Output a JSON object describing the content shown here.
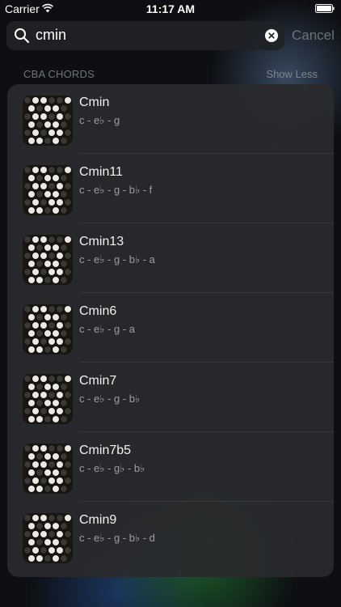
{
  "status_bar": {
    "carrier": "Carrier",
    "time": "11:17 AM"
  },
  "search": {
    "query": "cmin",
    "cancel_label": "Cancel"
  },
  "section": {
    "title": "CBA CHORDS",
    "toggle_label": "Show Less"
  },
  "results": [
    {
      "name": "Cmin",
      "notes": "c - e♭ - g"
    },
    {
      "name": "Cmin11",
      "notes": "c - e♭ - g - b♭ - f"
    },
    {
      "name": "Cmin13",
      "notes": "c - e♭ - g - b♭ - a"
    },
    {
      "name": "Cmin6",
      "notes": "c - e♭ - g - a"
    },
    {
      "name": "Cmin7",
      "notes": "c - e♭ - g - b♭"
    },
    {
      "name": "Cmin7b5",
      "notes": "c - e♭ - g♭ - b♭"
    },
    {
      "name": "Cmin9",
      "notes": "c - e♭ - g - b♭ - d"
    }
  ],
  "icons": {
    "search": "search-icon",
    "clear": "clear-icon",
    "wifi": "wifi-icon",
    "battery": "battery-icon",
    "thumbnail": "accordion-buttons-icon"
  },
  "colors": {
    "background": "#0d0f12",
    "card": "#292a2d",
    "accent_muted": "#6d7178"
  }
}
